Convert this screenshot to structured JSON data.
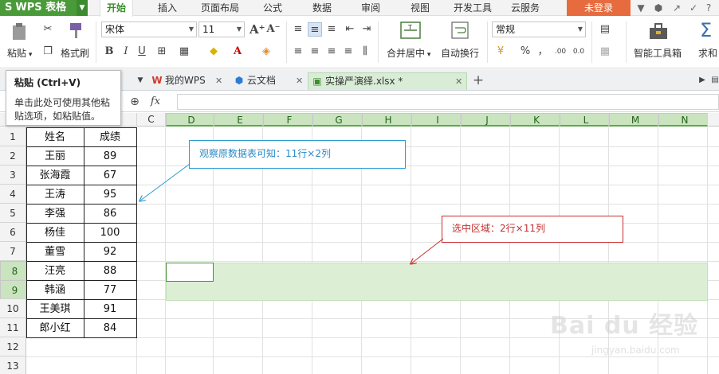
{
  "titlebar": {
    "app_name": "WPS 表格",
    "tabs": [
      "开始",
      "插入",
      "页面布局",
      "公式",
      "数据",
      "审阅",
      "视图",
      "开发工具",
      "云服务"
    ],
    "login": "未登录"
  },
  "ribbon": {
    "paste_label": "粘贴",
    "format_painter_label": "格式刷",
    "font_name": "宋体",
    "font_size": "11",
    "merge_center_label": "合并居中",
    "wrap_text_label": "自动换行",
    "number_format": "常规",
    "percent_symbol": "%",
    "comma_symbol": "，",
    "decimal_increase": ".00",
    "decimal_decrease": "0.0",
    "smart_toolbox_label": "智能工具箱",
    "sum_label": "求和",
    "sum_icon": "Σ"
  },
  "tooltip": {
    "title": "粘贴 (Ctrl+V)",
    "text": "单击此处可使用其他粘贴选项，如粘贴值。"
  },
  "tabs": {
    "my_wps": "我的WPS",
    "cloud_docs": "云文档",
    "workbook": "实操严演绎.xlsx *"
  },
  "formula_bar": {
    "fx_label": "fx"
  },
  "sheet": {
    "columns": [
      "C",
      "D",
      "E",
      "F",
      "G",
      "H",
      "I",
      "J",
      "K",
      "L",
      "M",
      "N"
    ],
    "rows": [
      "1",
      "2",
      "3",
      "4",
      "5",
      "6",
      "7",
      "8",
      "9",
      "10",
      "11",
      "12",
      "13"
    ],
    "header": [
      "姓名",
      "成绩"
    ],
    "data": [
      [
        "王丽",
        "89"
      ],
      [
        "张海霞",
        "67"
      ],
      [
        "王涛",
        "95"
      ],
      [
        "李强",
        "86"
      ],
      [
        "杨佳",
        "100"
      ],
      [
        "董雪",
        "92"
      ],
      [
        "汪亮",
        "88"
      ],
      [
        "韩涵",
        "77"
      ],
      [
        "王美琪",
        "91"
      ],
      [
        "郎小红",
        "84"
      ]
    ]
  },
  "annotations": {
    "note1": "观察原数据表可知：11行×2列",
    "note2": "选中区域：2行×11列",
    "note1_color": "#2a8bc7",
    "note2_color": "#c62f2f"
  },
  "watermark": {
    "logo": "Bai du 经验",
    "url": "jingyan.baidu.com"
  },
  "colors": {
    "brand_green": "#4a9a3a",
    "login_orange": "#e66b3e",
    "selection_fill": "#dcefd5"
  }
}
